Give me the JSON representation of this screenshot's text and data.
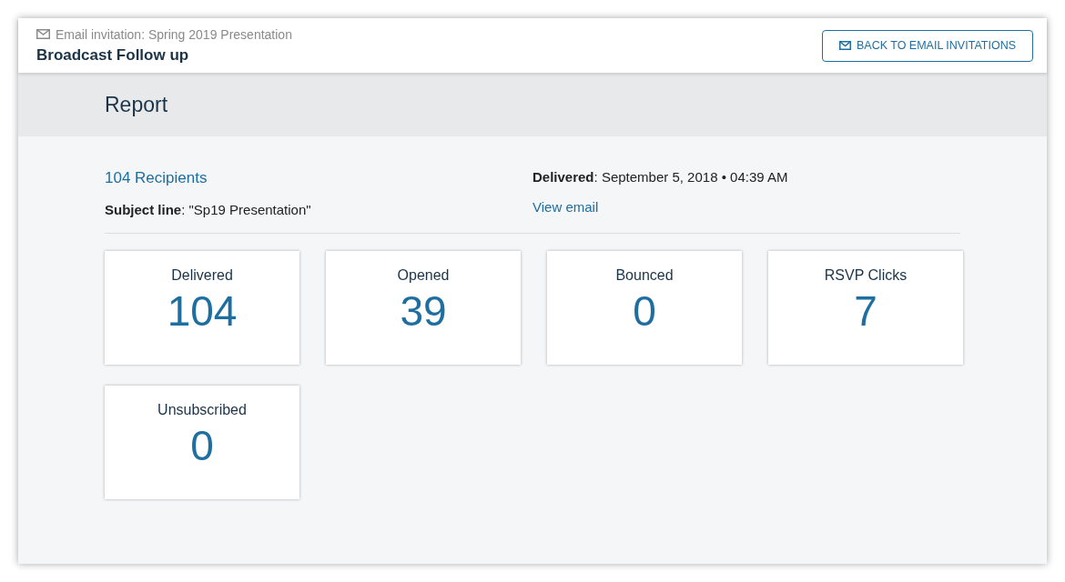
{
  "header": {
    "breadcrumb": "Email invitation: Spring 2019 Presentation",
    "title": "Broadcast Follow up",
    "back_button": "BACK TO EMAIL INVITATIONS"
  },
  "report": {
    "title": "Report",
    "recipients_link": "104 Recipients",
    "subject": "**Subject line**: \"Sp19 Presentation\"",
    "delivered": "**Delivered**: September 5, 2018 • 04:39 AM",
    "view_link": "View email",
    "stats": [
      {
        "label": "Delivered",
        "value": "104"
      },
      {
        "label": "Opened",
        "value": "39"
      },
      {
        "label": "Bounced",
        "value": "0"
      },
      {
        "label": "RSVP Clicks",
        "value": "7"
      },
      {
        "label": "Unsubscribed",
        "value": "0"
      }
    ]
  }
}
